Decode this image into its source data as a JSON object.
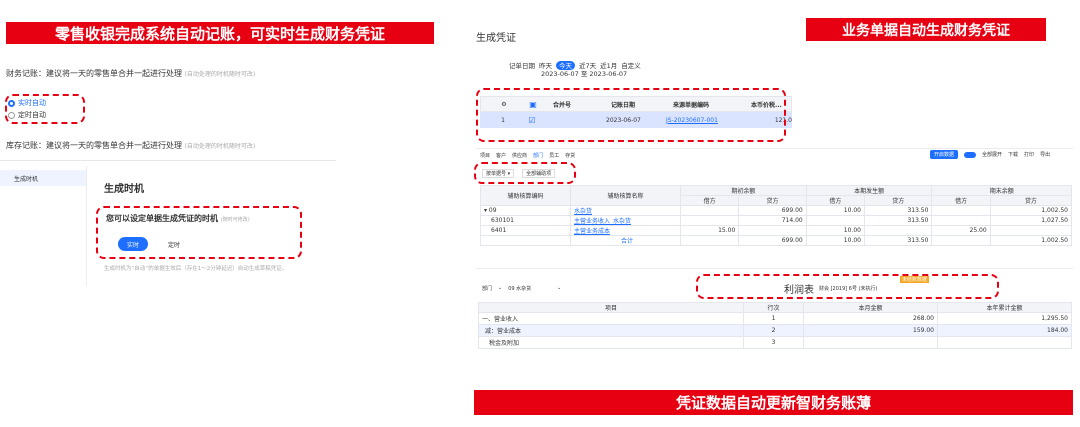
{
  "banners": {
    "top_left": "零售收银完成系统自动记账，可实时生成财务凭证",
    "top_right": "业务单据自动生成财务凭证",
    "bottom_right": "凭证数据自动更新智财务账薄"
  },
  "left": {
    "finance_label": "财务记账：建议将一天的零售单合并一起进行处理",
    "finance_hint": "(自动处理的时机随时可改)",
    "radio_realtime": "实时自动",
    "radio_scheduled": "定时自动",
    "inventory_label": "库存记账：建议将一天的零售单合并一起进行处理",
    "inventory_hint": "(自动处理的时机随时可改)",
    "sidebar_item": "生成时机",
    "section_title": "生成时机",
    "prompt": "您可以设定单据生成凭证的时机",
    "prompt_hint": "(随时可修改)",
    "btn_realtime": "实时",
    "btn_scheduled": "定时",
    "note": "生成时机为“自动”的单据生效后（存在1～2分钟延迟）自动生成草稿凭证。"
  },
  "voucher": {
    "title": "生成凭证",
    "date_label": "记单日期",
    "presets": [
      "昨天",
      "今天",
      "近7天",
      "近1月",
      "自定义"
    ],
    "date_range": "2023-06-07 至 2023-06-07",
    "headers": [
      "合并号",
      "记账日期",
      "来源单据编码",
      "本币价税..."
    ],
    "row": {
      "index": "1",
      "date": "2023-06-07",
      "code": "JS-20230607-001",
      "amount": "121.0"
    }
  },
  "ledger": {
    "tabs": [
      "项目",
      "客户",
      "供应商",
      "部门",
      "员工",
      "存货"
    ],
    "actions": [
      "开启数据",
      "全部展开",
      "下载",
      "打印",
      "导出"
    ],
    "filter1": "按单据号",
    "filter2": "全部辅助项",
    "col_code": "辅助核算编码",
    "col_name": "辅助核算名称",
    "groups": [
      "期初余额",
      "本期发生额",
      "期末余额"
    ],
    "subcols": [
      "借方",
      "贷方",
      "借方",
      "贷方",
      "借方",
      "贷方"
    ],
    "rows": [
      {
        "code": "▾ 09",
        "name": "水杂货",
        "v": [
          "",
          "",
          "699.00",
          "10.00",
          "313.50",
          "",
          "",
          "1,002.50"
        ]
      },
      {
        "code": "630101",
        "name": "主营业务收入_水杂货",
        "v": [
          "",
          "",
          "714.00",
          "",
          "313.50",
          "",
          "",
          "1,027.50"
        ]
      },
      {
        "code": "6401",
        "name": "主营业务成本",
        "v": [
          "",
          "15.00",
          "",
          "10.00",
          "",
          "",
          "25.00",
          ""
        ]
      },
      {
        "code": "",
        "name": "合计",
        "v": [
          "",
          "",
          "699.00",
          "10.00",
          "313.50",
          "",
          "",
          "1,002.50"
        ]
      }
    ]
  },
  "profit": {
    "dept_label": "部门",
    "dept_value": "09 水杂货",
    "title": "利润表",
    "subtitle": "财会 [2019] 6号 (未执行)",
    "badge": "未结账数据",
    "headers": [
      "项目",
      "行次",
      "本月金额",
      "本年累计金额"
    ],
    "rows": [
      {
        "item": "一、营业收入",
        "line": "1",
        "month": "268.00",
        "year": "1,295.50"
      },
      {
        "item": "减：营业成本",
        "line": "2",
        "month": "159.00",
        "year": "184.00"
      },
      {
        "item": "税金及附加",
        "line": "3",
        "month": "",
        "year": ""
      }
    ]
  },
  "colors": {
    "accent": "#e60012",
    "brand": "#1e6fff"
  }
}
